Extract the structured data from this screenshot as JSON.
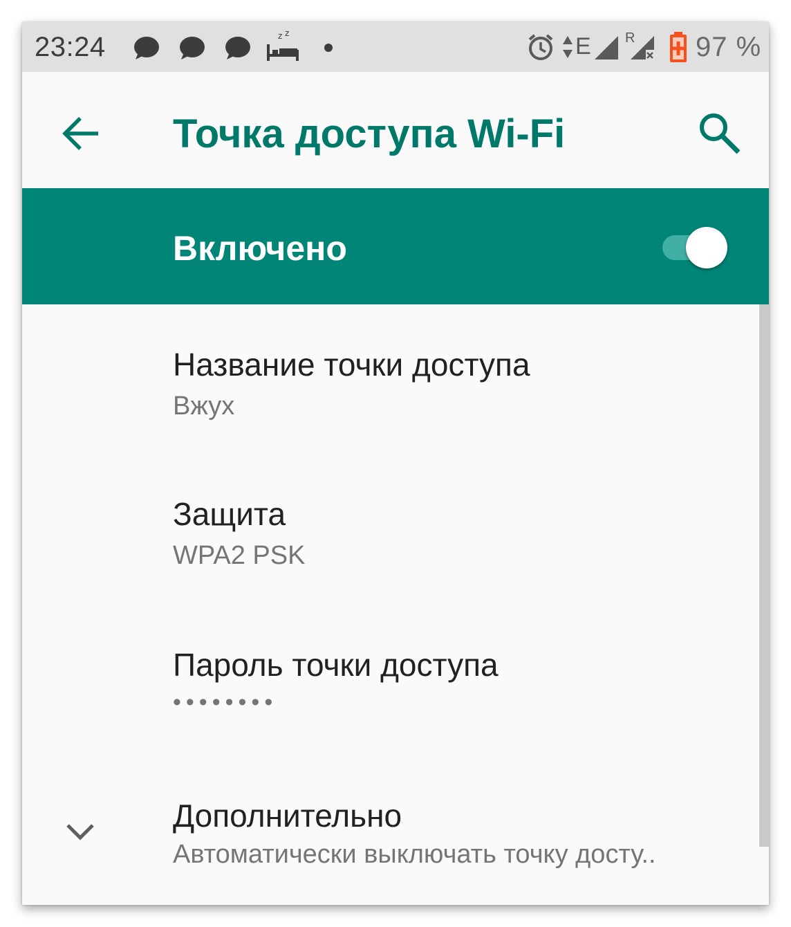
{
  "status_bar": {
    "time": "23:24",
    "battery_percent": "97 %",
    "network_label": "E",
    "roaming_label": "R",
    "icons": [
      "chat-bubble-icon",
      "chat-bubble-icon",
      "chat-bubble-icon",
      "sleep-bed-icon",
      "dot-icon",
      "alarm-icon",
      "data-arrows-icon",
      "signal-icon",
      "signal-roaming-icon",
      "battery-charging-icon"
    ]
  },
  "app_bar": {
    "title": "Точка доступа Wi-Fi",
    "back_icon": "arrow-back-icon",
    "search_icon": "search-icon"
  },
  "master_switch": {
    "label": "Включено",
    "state": "on"
  },
  "items": [
    {
      "title": "Название точки доступа",
      "summary": "Вжух"
    },
    {
      "title": "Защита",
      "summary": "WPA2 PSK"
    },
    {
      "title": "Пароль точки доступа",
      "summary": "••••••••"
    },
    {
      "title": "Дополнительно",
      "summary": "Автоматически выключать точку досту..",
      "icon": "chevron-down-icon"
    }
  ],
  "colors": {
    "accent": "#00796b",
    "bar": "#008577",
    "status_bar": "#e0e0e0",
    "battery": "#f4511e"
  }
}
